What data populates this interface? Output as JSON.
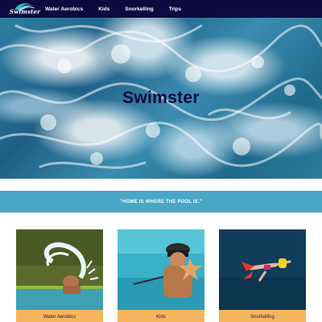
{
  "nav": {
    "logo_text": "Swimster",
    "links": [
      {
        "label": "Water Aerobics"
      },
      {
        "label": "Kids"
      },
      {
        "label": "Snorkelling"
      },
      {
        "label": "Trips"
      }
    ]
  },
  "hero": {
    "title": "Swimster"
  },
  "quote": {
    "text": "\"HOME IS WHERE THE POOL IS.\""
  },
  "cards": [
    {
      "label": "Water Aerobics",
      "icon": "hair-flip-swimmer-photo"
    },
    {
      "label": "Kids",
      "icon": "kid-with-starfish-photo"
    },
    {
      "label": "Snorkelling",
      "icon": "snorkeler-photo"
    }
  ],
  "colors": {
    "nav_bg": "#0c0a3e",
    "hero_title": "#0c0a3e",
    "quote_bg": "#48a6c6",
    "card_label_bg": "#f6b55d"
  }
}
